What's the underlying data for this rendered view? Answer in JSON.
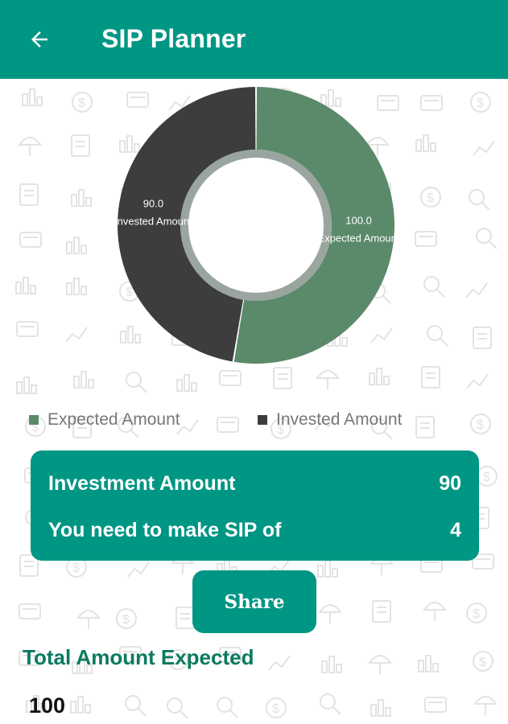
{
  "app_bar": {
    "title": "SIP Planner",
    "back_icon": "arrow-left-icon",
    "color": "#009684"
  },
  "chart_data": {
    "type": "pie",
    "title": "",
    "style": "donut",
    "slices": [
      {
        "name": "Expected Amount",
        "value": 100.0,
        "value_label": "100.0",
        "label": "Expected Amount",
        "color": "#5a8a6a"
      },
      {
        "name": "Invested Amount",
        "value": 90.0,
        "value_label": "90.0",
        "label": "Invested Amount",
        "color": "#3d3d3d"
      }
    ],
    "legend": {
      "placement": "bottom",
      "entries": [
        "Expected Amount",
        "Invested Amount"
      ]
    }
  },
  "result": {
    "investment_label": "Investment Amount",
    "investment_value": "90",
    "sip_label": "You need to make SIP of",
    "sip_value": "4"
  },
  "share_label": "Share",
  "total": {
    "label": "Total Amount Expected",
    "value": "100"
  },
  "colors": {
    "primary": "#009684",
    "total_label": "#0b7a5f"
  }
}
